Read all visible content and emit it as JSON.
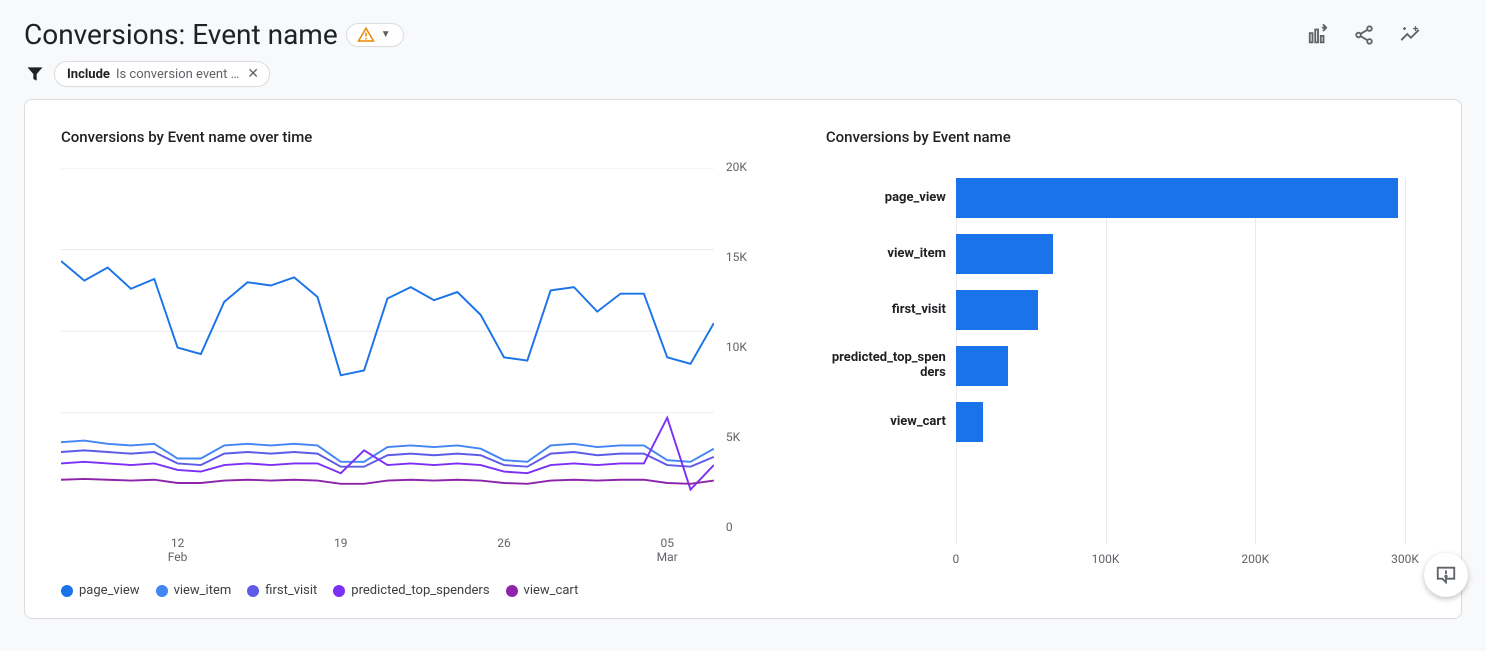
{
  "header": {
    "title": "Conversions: Event name",
    "warning_icon": "warning-triangle"
  },
  "filter": {
    "include_label": "Include",
    "text": "Is conversion event …"
  },
  "line_panel": {
    "title": "Conversions by Event name over time"
  },
  "bar_panel": {
    "title": "Conversions by Event name"
  },
  "colors": {
    "page_view": "#1a73e8",
    "view_item": "#4285f4",
    "first_visit": "#5e5ce6",
    "predicted_top_spenders": "#7b2ff7",
    "view_cart": "#8e24aa"
  },
  "chart_data": [
    {
      "type": "line",
      "title": "Conversions by Event name over time",
      "xlabel": "",
      "ylabel": "",
      "ylim": [
        0,
        20000
      ],
      "y_ticks": [
        "20K",
        "15K",
        "10K",
        "5K",
        "0"
      ],
      "x_dates": [
        "07 Feb",
        "08 Feb",
        "09 Feb",
        "10 Feb",
        "11 Feb",
        "12 Feb",
        "13 Feb",
        "14 Feb",
        "15 Feb",
        "16 Feb",
        "17 Feb",
        "18 Feb",
        "19 Feb",
        "20 Feb",
        "21 Feb",
        "22 Feb",
        "23 Feb",
        "24 Feb",
        "25 Feb",
        "26 Feb",
        "27 Feb",
        "28 Feb",
        "01 Mar",
        "02 Mar",
        "03 Mar",
        "04 Mar",
        "05 Mar",
        "06 Mar",
        "07 Mar"
      ],
      "x_tick_labels": [
        {
          "pos_index": 5,
          "line1": "12",
          "line2": "Feb"
        },
        {
          "pos_index": 12,
          "line1": "19",
          "line2": ""
        },
        {
          "pos_index": 19,
          "line1": "26",
          "line2": ""
        },
        {
          "pos_index": 26,
          "line1": "05",
          "line2": "Mar"
        }
      ],
      "series": [
        {
          "name": "page_view",
          "color_key": "page_view",
          "values": [
            14300,
            13100,
            13900,
            12600,
            13200,
            9000,
            8600,
            11800,
            13000,
            12800,
            13300,
            12100,
            7300,
            7600,
            12000,
            12700,
            11900,
            12400,
            11000,
            8400,
            8200,
            12500,
            12700,
            11200,
            12300,
            12300,
            8400,
            8000,
            10500
          ]
        },
        {
          "name": "view_item",
          "color_key": "view_item",
          "values": [
            3200,
            3300,
            3100,
            3000,
            3100,
            2200,
            2200,
            3000,
            3100,
            3000,
            3100,
            3000,
            2000,
            2000,
            2900,
            3000,
            2900,
            3000,
            2800,
            2100,
            2000,
            3000,
            3100,
            2900,
            3000,
            3000,
            2100,
            2000,
            2800
          ]
        },
        {
          "name": "first_visit",
          "color_key": "first_visit",
          "values": [
            2600,
            2700,
            2600,
            2500,
            2600,
            1900,
            1800,
            2500,
            2600,
            2500,
            2600,
            2500,
            1700,
            1700,
            2400,
            2500,
            2400,
            2500,
            2400,
            1800,
            1700,
            2500,
            2600,
            2400,
            2500,
            2500,
            1800,
            1700,
            2300
          ]
        },
        {
          "name": "predicted_top_spenders",
          "color_key": "predicted_top_spenders",
          "values": [
            1900,
            2000,
            1900,
            1800,
            1900,
            1500,
            1400,
            1800,
            1900,
            1800,
            1900,
            1900,
            1300,
            2700,
            1800,
            1900,
            1800,
            1900,
            1800,
            1400,
            1300,
            1800,
            1900,
            1800,
            1900,
            1900,
            4700,
            300,
            1800
          ]
        },
        {
          "name": "view_cart",
          "color_key": "view_cart",
          "values": [
            900,
            950,
            900,
            850,
            900,
            700,
            700,
            850,
            900,
            850,
            900,
            850,
            650,
            650,
            850,
            900,
            850,
            900,
            850,
            700,
            650,
            850,
            900,
            850,
            900,
            900,
            700,
            650,
            850
          ]
        }
      ],
      "legend": [
        "page_view",
        "view_item",
        "first_visit",
        "predicted_top_spenders",
        "view_cart"
      ]
    },
    {
      "type": "bar",
      "orientation": "horizontal",
      "title": "Conversions by Event name",
      "xlabel": "",
      "ylabel": "",
      "xlim": [
        0,
        300000
      ],
      "x_ticks": [
        {
          "value": 0,
          "label": "0"
        },
        {
          "value": 100000,
          "label": "100K"
        },
        {
          "value": 200000,
          "label": "200K"
        },
        {
          "value": 300000,
          "label": "300K"
        }
      ],
      "categories": [
        "page_view",
        "view_item",
        "first_visit",
        "predicted_top_spenders",
        "view_cart"
      ],
      "values": [
        295000,
        65000,
        55000,
        35000,
        18000
      ]
    }
  ]
}
